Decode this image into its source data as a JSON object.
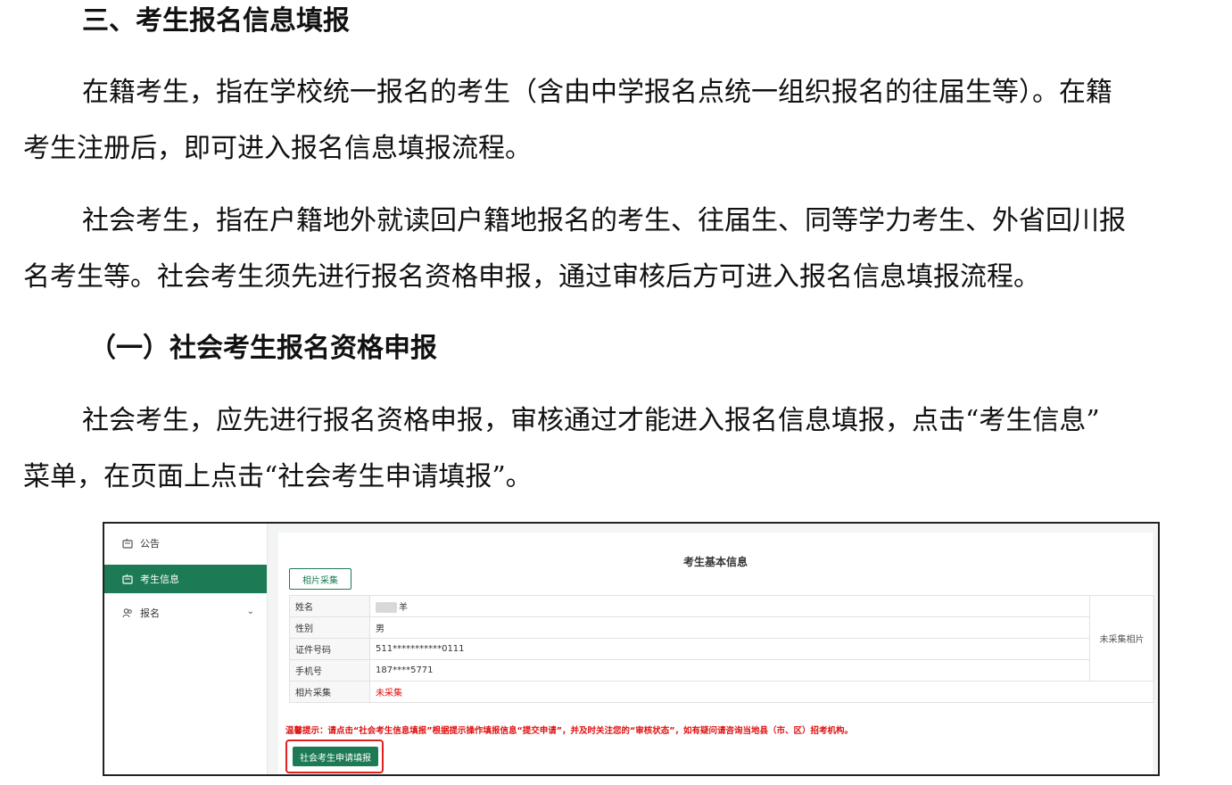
{
  "document": {
    "heading_main": "三、考生报名信息填报",
    "para1_line1": "在籍考生，指在学校统一报名的考生（含由中学报名点统一组织报名的往届生等）。在籍",
    "para1_line2": "考生注册后，即可进入报名信息填报流程。",
    "para2_line1": "社会考生，指在户籍地外就读回户籍地报名的考生、往届生、同等学力考生、外省回川报",
    "para2_line2": "名考生等。社会考生须先进行报名资格申报，通过审核后方可进入报名信息填报流程。",
    "heading_sub": "（一）社会考生报名资格申报",
    "para3_line1": "社会考生，应先进行报名资格申报，审核通过才能进入报名信息填报，点击“考生信息”",
    "para3_line2": "菜单，在页面上点击“社会考生申请填报”。"
  },
  "screenshot": {
    "sidebar": {
      "items": [
        {
          "label": "公告",
          "icon": "notice-icon"
        },
        {
          "label": "考生信息",
          "icon": "id-card-icon"
        },
        {
          "label": "报名",
          "icon": "users-icon"
        }
      ],
      "active_index": 1
    },
    "card": {
      "title": "考生基本信息",
      "photo_button": "相片采集",
      "rows": [
        {
          "label": "姓名",
          "value": "羊"
        },
        {
          "label": "性别",
          "value": "男"
        },
        {
          "label": "证件号码",
          "value": "511***********0111"
        },
        {
          "label": "手机号",
          "value": "187****5771"
        },
        {
          "label": "相片采集",
          "value": "未采集"
        }
      ],
      "photo_placeholder": "未采集相片",
      "tip": "温馨提示：请点击“社会考生信息填报”根据提示操作填报信息“提交申请”，并及时关注您的“审核状态”，如有疑问请咨询当地县（市、区）招考机构。",
      "apply_button": "社会考生申请填报"
    },
    "colors": {
      "accent": "#1c7a55",
      "warning": "#e01010"
    }
  }
}
